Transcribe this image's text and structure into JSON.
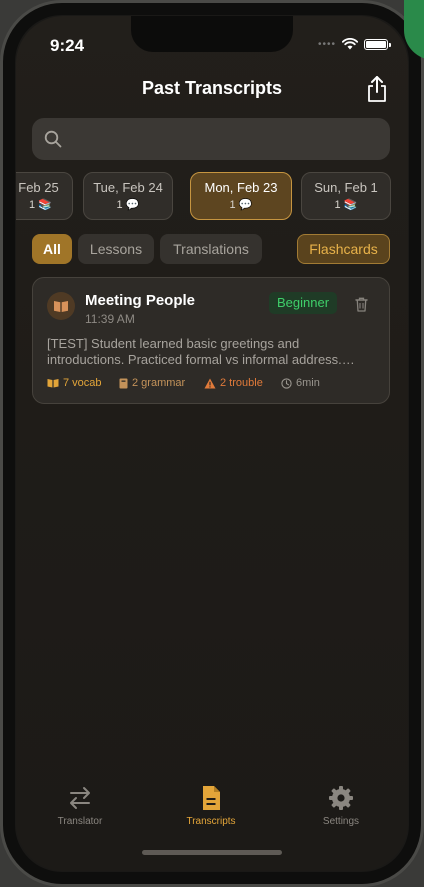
{
  "status": {
    "time": "9:24"
  },
  "header": {
    "title": "Past Transcripts",
    "share_icon": "share-icon"
  },
  "search": {
    "placeholder": "",
    "value": ""
  },
  "dates": [
    {
      "label": "Feb 25",
      "count": "1"
    },
    {
      "label": "Tue, Feb 24",
      "count": "1"
    },
    {
      "label": "Mon, Feb 23",
      "count": "1",
      "selected": true
    },
    {
      "label": "Sun, Feb 1",
      "count": "1"
    }
  ],
  "filters": {
    "all": "All",
    "lessons": "Lessons",
    "translations": "Translations",
    "flashcards": "Flashcards"
  },
  "transcript": {
    "title": "Meeting People",
    "time": "11:39 AM",
    "level": "Beginner",
    "summary": "[TEST] Student learned basic greetings and introductions. Practiced formal vs informal address. Reviewed common phrases for meeting new people.",
    "vocab": "7 vocab",
    "grammar": "2 grammar",
    "trouble": "2 trouble",
    "duration": "6min"
  },
  "tabs": [
    {
      "label": "Translator",
      "icon": "translate-arrows-icon"
    },
    {
      "label": "Transcripts",
      "icon": "document-icon",
      "active": true
    },
    {
      "label": "Settings",
      "icon": "gear-icon"
    }
  ],
  "colors": {
    "accent": "#e3a539",
    "beginner": "#3fcf6a",
    "trouble": "#e07a3a",
    "background": "#1f1c18"
  }
}
